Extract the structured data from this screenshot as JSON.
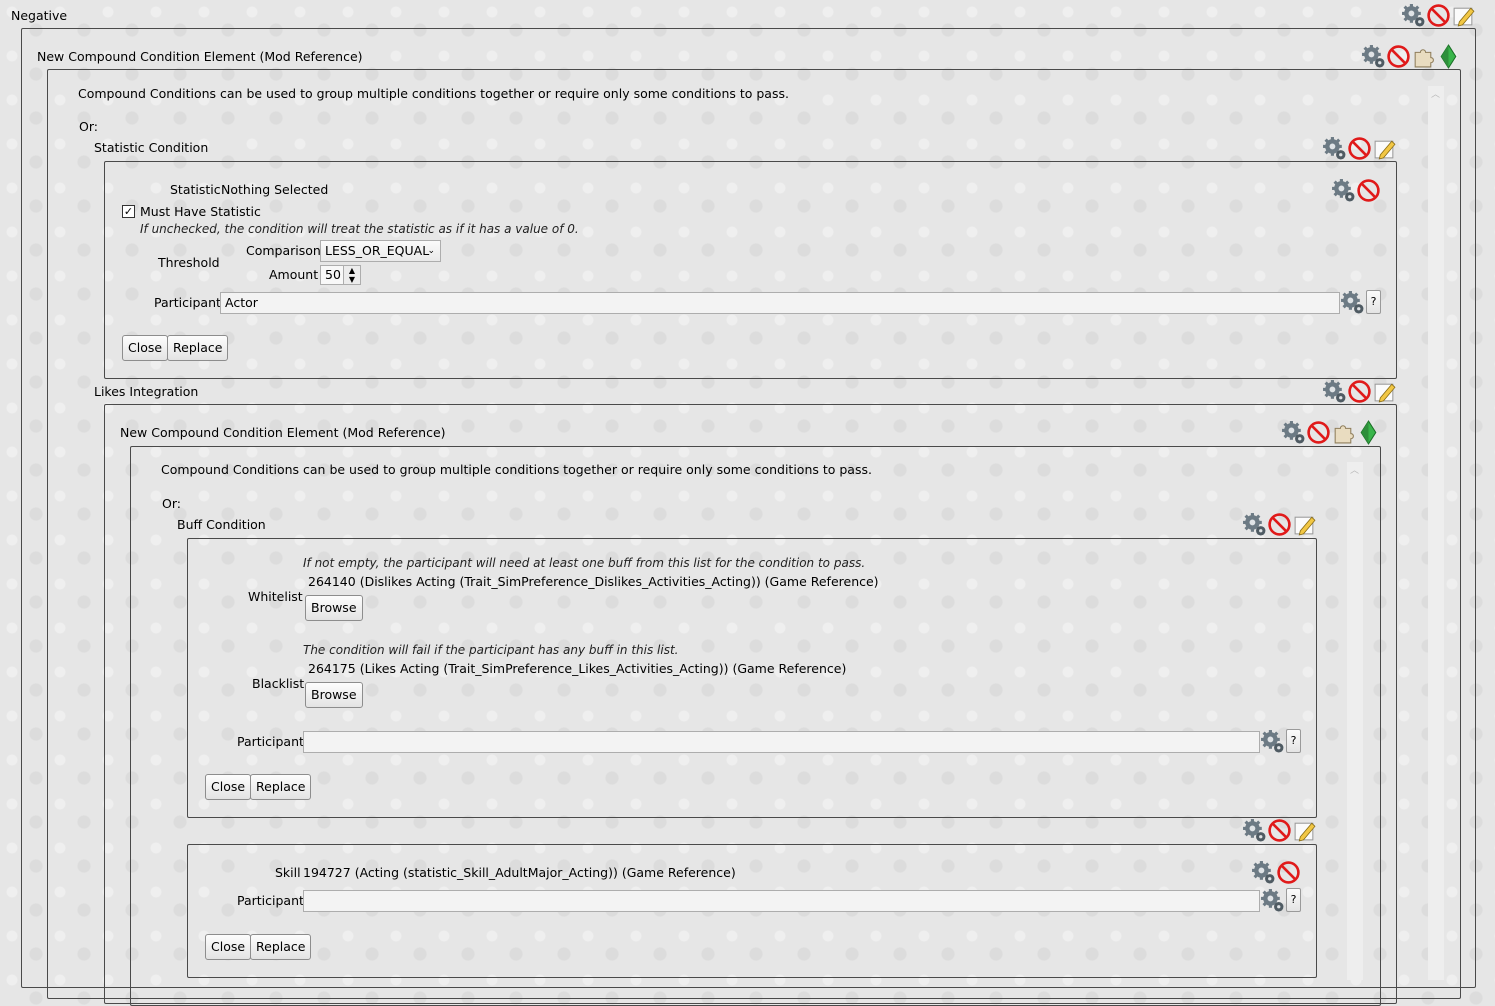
{
  "negative": {
    "title": "Negative"
  },
  "outer_compound": {
    "title": "New Compound Condition Element (Mod Reference)",
    "description": "Compound Conditions can be used to group multiple conditions together or require only some conditions to pass.",
    "or_label": "Or:"
  },
  "statistic_condition": {
    "title": "Statistic Condition",
    "statistic_label": "Statistic",
    "statistic_value": "Nothing Selected",
    "must_have_label": "Must Have Statistic",
    "must_have_checked": true,
    "must_have_hint": "If unchecked, the condition will treat the statistic as if it has a value of 0.",
    "threshold_label": "Threshold",
    "comparison_label": "Comparison",
    "comparison_value": "LESS_OR_EQUAL",
    "amount_label": "Amount",
    "amount_value": "50",
    "participant_label": "Participant",
    "participant_value": "Actor",
    "help_label": "?",
    "close_label": "Close",
    "replace_label": "Replace"
  },
  "likes_integration": {
    "title": "Likes Integration",
    "inner_compound": {
      "title": "New Compound Condition Element (Mod Reference)",
      "description": "Compound Conditions can be used to group multiple conditions together or require only some conditions to pass.",
      "or_label": "Or:"
    }
  },
  "buff_condition": {
    "title": "Buff Condition",
    "whitelist_hint": "If not empty, the participant will need at least one buff from this list for the condition to pass.",
    "whitelist_label": "Whitelist",
    "whitelist_item": "264140 (Dislikes Acting (Trait_SimPreference_Dislikes_Activities_Acting)) (Game Reference)",
    "browse_label": "Browse",
    "blacklist_hint": "The condition will fail if the participant has any buff in this list.",
    "blacklist_label": "Blacklist",
    "blacklist_item": "264175 (Likes Acting (Trait_SimPreference_Likes_Activities_Acting)) (Game Reference)",
    "participant_label": "Participant",
    "participant_value": "",
    "help_label": "?",
    "close_label": "Close",
    "replace_label": "Replace"
  },
  "skill_condition": {
    "skill_label": "Skill",
    "skill_value": "194727 (Acting (statistic_Skill_AdultMajor_Acting)) (Game Reference)",
    "participant_label": "Participant",
    "participant_value": "",
    "help_label": "?",
    "close_label": "Close",
    "replace_label": "Replace"
  },
  "icons": {
    "settings": "gear-icon",
    "remove": "remove-icon",
    "edit": "pencil-icon",
    "puzzle": "puzzle-icon",
    "plumbob": "plumbob-icon"
  },
  "colors": {
    "remove_red": "#e01a1a",
    "plumbob_green": "#2fa83a",
    "gear_gray": "#5f6a72"
  }
}
